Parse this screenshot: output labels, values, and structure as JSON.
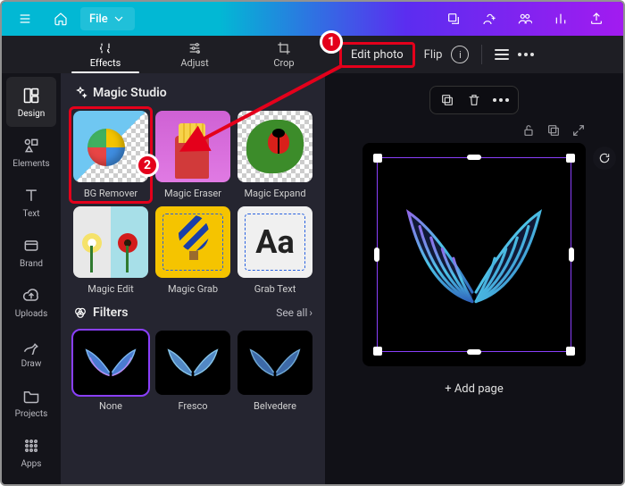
{
  "topbar": {
    "file_label": "File"
  },
  "left_rail": [
    {
      "id": "design",
      "label": "Design"
    },
    {
      "id": "elements",
      "label": "Elements"
    },
    {
      "id": "text",
      "label": "Text"
    },
    {
      "id": "brand",
      "label": "Brand"
    },
    {
      "id": "uploads",
      "label": "Uploads"
    },
    {
      "id": "draw",
      "label": "Draw"
    },
    {
      "id": "projects",
      "label": "Projects"
    },
    {
      "id": "apps",
      "label": "Apps"
    }
  ],
  "panel_tabs": {
    "effects": "Effects",
    "adjust": "Adjust",
    "crop": "Crop"
  },
  "toolbar": {
    "edit_photo": "Edit photo",
    "flip": "Flip"
  },
  "magic_studio": {
    "title": "Magic Studio",
    "tools": [
      {
        "id": "bg-remover",
        "label": "BG Remover"
      },
      {
        "id": "magic-eraser",
        "label": "Magic Eraser"
      },
      {
        "id": "magic-expand",
        "label": "Magic Expand"
      },
      {
        "id": "magic-edit",
        "label": "Magic Edit"
      },
      {
        "id": "magic-grab",
        "label": "Magic Grab"
      },
      {
        "id": "grab-text",
        "label": "Grab Text"
      }
    ]
  },
  "filters": {
    "title": "Filters",
    "see_all": "See all",
    "items": [
      {
        "id": "none",
        "label": "None"
      },
      {
        "id": "fresco",
        "label": "Fresco"
      },
      {
        "id": "belvedere",
        "label": "Belvedere"
      }
    ]
  },
  "canvas": {
    "add_page": "+ Add page"
  },
  "annotations": {
    "step1": "1",
    "step2": "2"
  },
  "grab_text_sample": "Aa"
}
